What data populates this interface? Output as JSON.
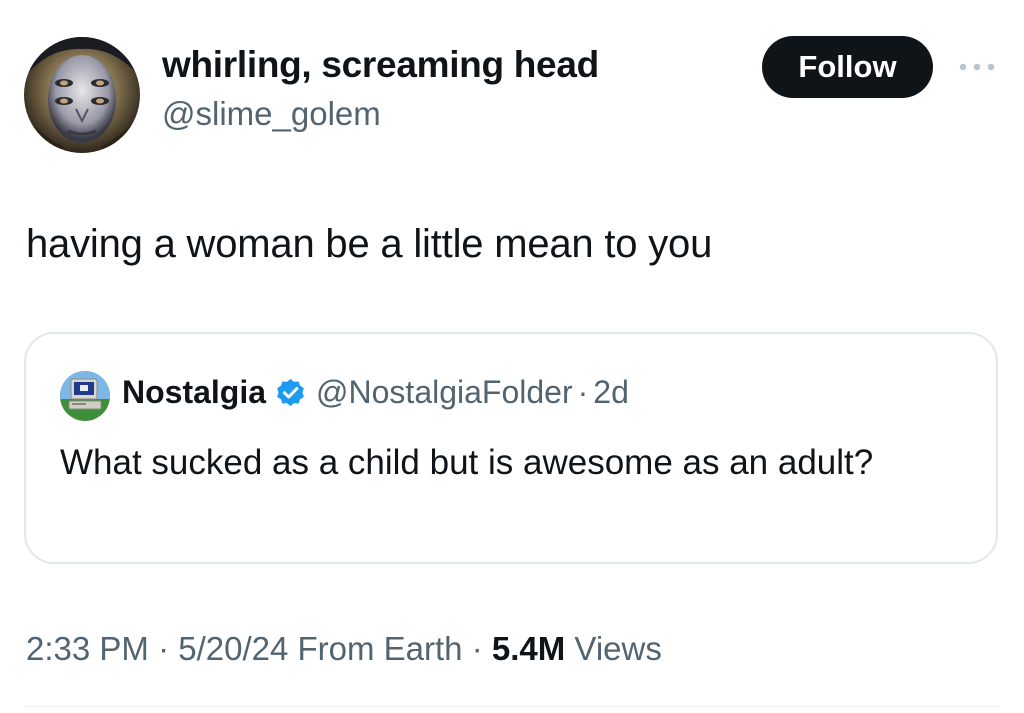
{
  "author": {
    "display_name": "whirling, screaming head",
    "handle": "@slime_golem"
  },
  "actions": {
    "follow_label": "Follow",
    "more_icon": "more-horizontal-icon"
  },
  "tweet": {
    "text": "having a woman be a little mean to you"
  },
  "quoted_tweet": {
    "display_name": "Nostalgia",
    "verified_icon": "verified-badge-icon",
    "verified_color": "#1d9bf0",
    "handle": "@NostalgiaFolder",
    "separator": "·",
    "time": "2d",
    "text": "What sucked as a child but is awesome as an adult?"
  },
  "meta": {
    "timestamp": "2:33 PM · 5/20/24 From Earth · ",
    "views_count": "5.4M",
    "views_label": " Views"
  },
  "colors": {
    "text_primary": "#0f1419",
    "text_secondary": "#536471",
    "follow_button_bg": "#0f1419",
    "border": "#e3e8ec"
  }
}
